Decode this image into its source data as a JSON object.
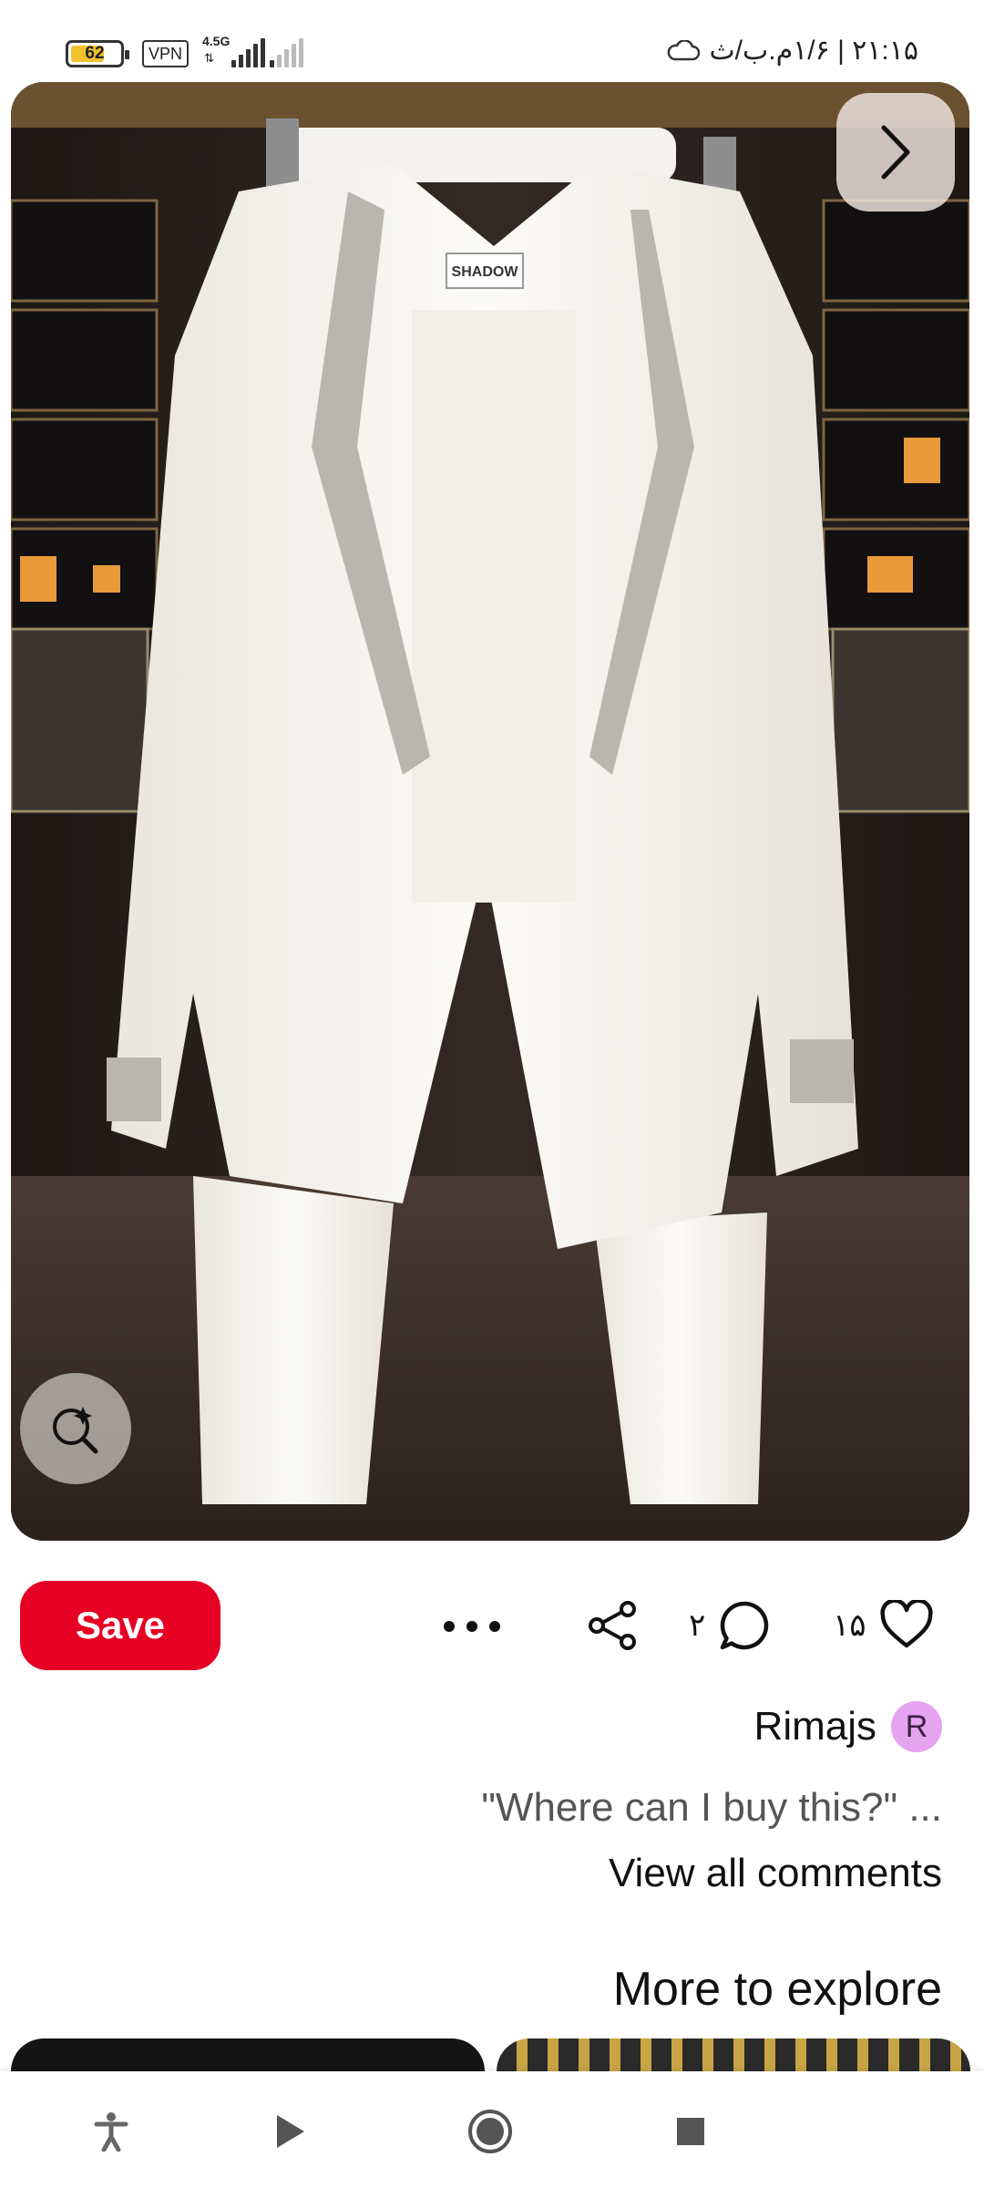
{
  "status_bar": {
    "battery": "62",
    "vpn": "VPN",
    "network_type": "4.5G",
    "time_date": "۲۱:۱۵ | ۱/۶م.ب/ث"
  },
  "pin": {
    "image_label": "SHADOW",
    "save_label": "Save",
    "comment_count": "۲",
    "like_count": "۱۵"
  },
  "author": {
    "name": "Rimajs",
    "avatar_letter": "R"
  },
  "comments": {
    "preview": "\"Where can I buy this?\" ...",
    "view_all": "View all comments"
  },
  "explore": {
    "title": "More to explore"
  },
  "colors": {
    "save_button": "#e60023",
    "avatar_bg": "#e5a3f0"
  },
  "icons": {
    "next": "chevron-right-icon",
    "lens": "visual-search-icon",
    "more": "more-horizontal-icon",
    "share": "share-icon",
    "comment": "comment-icon",
    "like": "heart-icon",
    "nav": [
      "accessibility-icon",
      "play-icon",
      "home-circle-icon",
      "stop-square-icon"
    ]
  }
}
